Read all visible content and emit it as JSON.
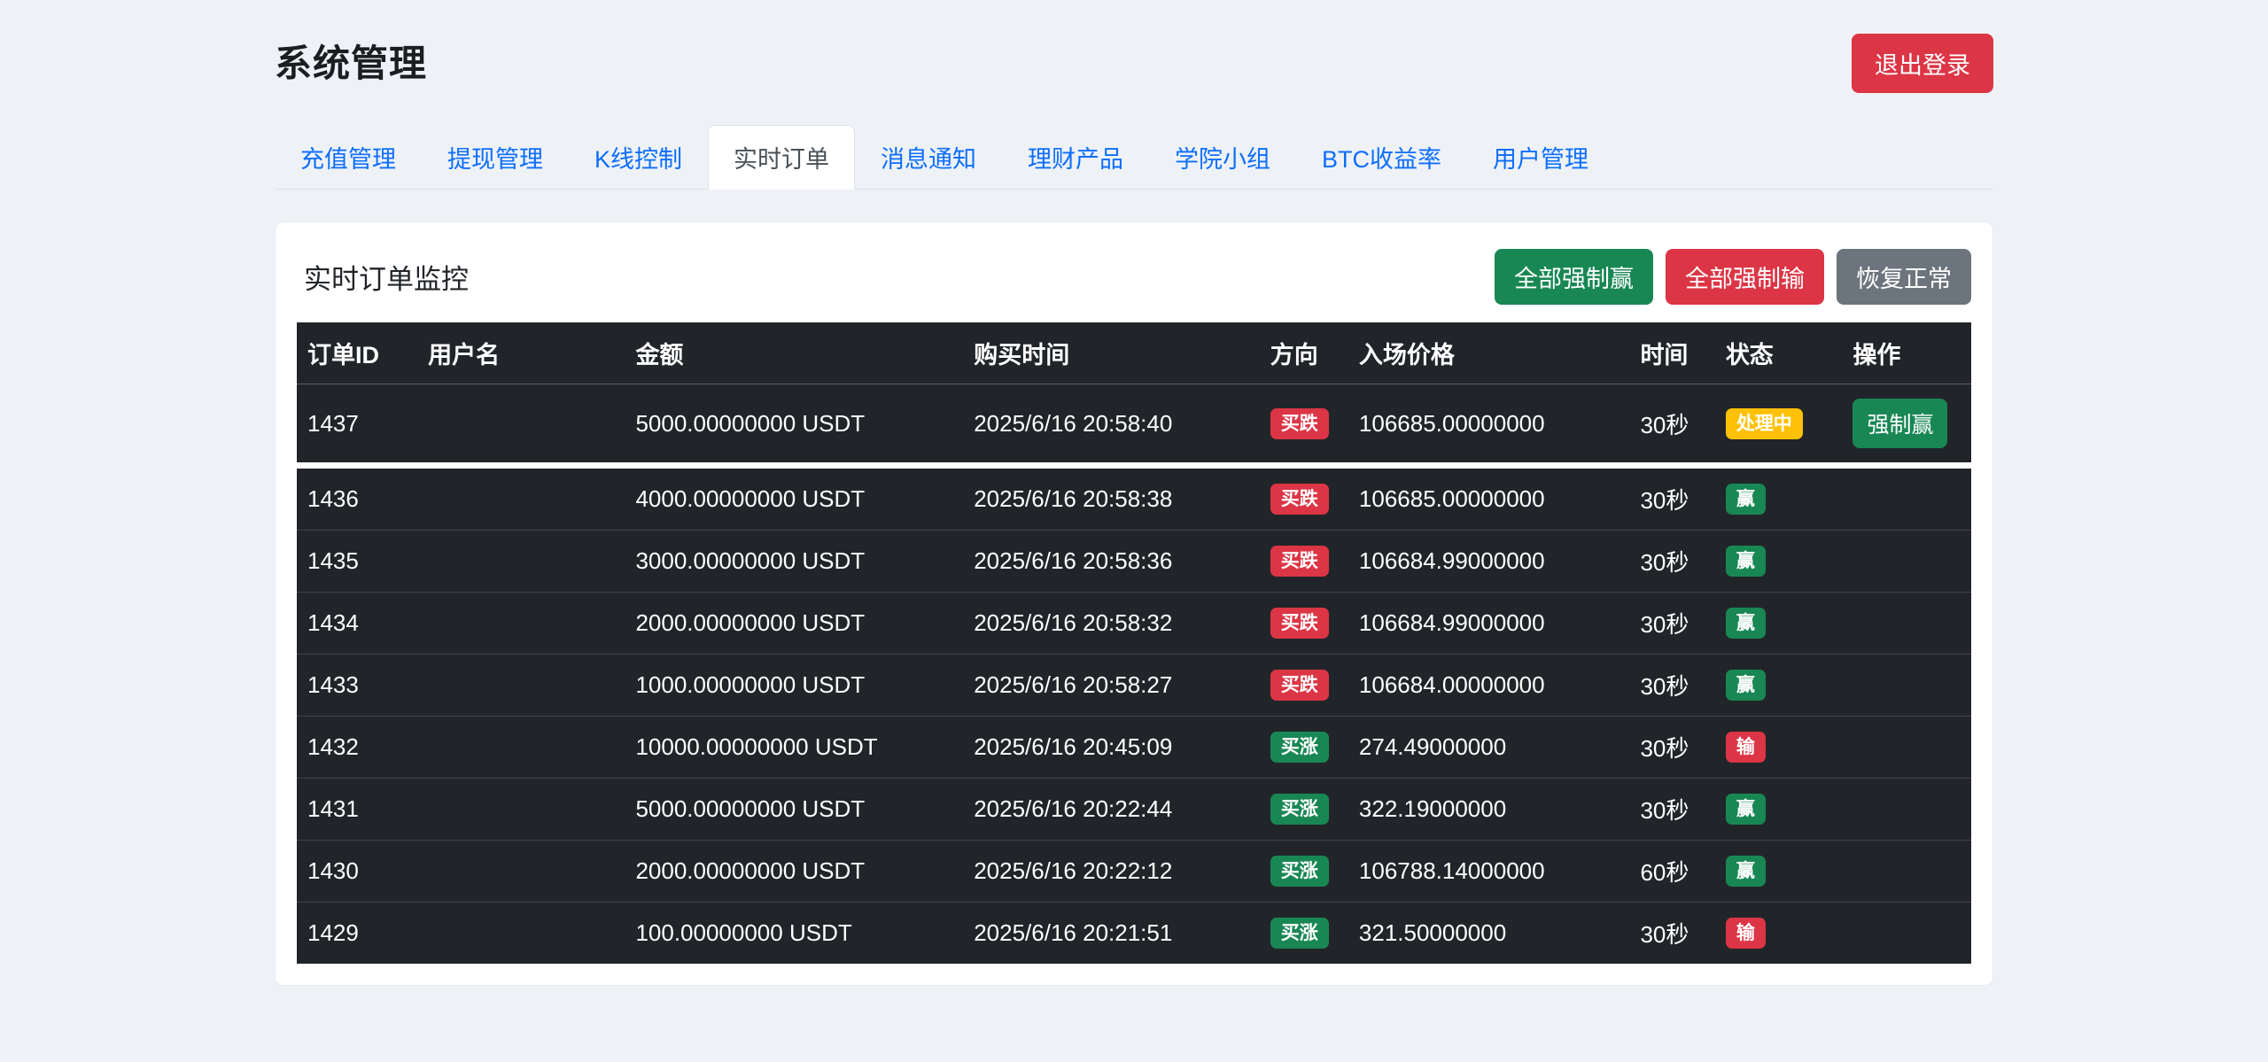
{
  "page": {
    "title": "系统管理",
    "logout_label": "退出登录"
  },
  "tabs": [
    {
      "label": "充值管理",
      "active": false
    },
    {
      "label": "提现管理",
      "active": false
    },
    {
      "label": "K线控制",
      "active": false
    },
    {
      "label": "实时订单",
      "active": true
    },
    {
      "label": "消息通知",
      "active": false
    },
    {
      "label": "理财产品",
      "active": false
    },
    {
      "label": "学院小组",
      "active": false
    },
    {
      "label": "BTC收益率",
      "active": false
    },
    {
      "label": "用户管理",
      "active": false
    }
  ],
  "panel": {
    "title": "实时订单监控",
    "buttons": [
      {
        "name": "force-all-win-button",
        "label": "全部强制赢",
        "variant": "success"
      },
      {
        "name": "force-all-lose-button",
        "label": "全部强制输",
        "variant": "danger"
      },
      {
        "name": "restore-normal-button",
        "label": "恢复正常",
        "variant": "secondary"
      }
    ]
  },
  "table": {
    "headers": [
      "订单ID",
      "用户名",
      "金额",
      "购买时间",
      "方向",
      "入场价格",
      "时间",
      "状态",
      "操作"
    ],
    "rows": [
      {
        "id": "1437",
        "username": "",
        "amount": "5000.00000000 USDT",
        "buy_time": "2025/6/16 20:58:40",
        "direction": "买跌",
        "direction_type": "down",
        "price": "106685.00000000",
        "duration": "30秒",
        "status": "处理中",
        "status_type": "processing",
        "action": "强制赢",
        "group_break": true
      },
      {
        "id": "1436",
        "username": "",
        "amount": "4000.00000000 USDT",
        "buy_time": "2025/6/16 20:58:38",
        "direction": "买跌",
        "direction_type": "down",
        "price": "106685.00000000",
        "duration": "30秒",
        "status": "赢",
        "status_type": "win",
        "action": ""
      },
      {
        "id": "1435",
        "username": "",
        "amount": "3000.00000000 USDT",
        "buy_time": "2025/6/16 20:58:36",
        "direction": "买跌",
        "direction_type": "down",
        "price": "106684.99000000",
        "duration": "30秒",
        "status": "赢",
        "status_type": "win",
        "action": ""
      },
      {
        "id": "1434",
        "username": "",
        "amount": "2000.00000000 USDT",
        "buy_time": "2025/6/16 20:58:32",
        "direction": "买跌",
        "direction_type": "down",
        "price": "106684.99000000",
        "duration": "30秒",
        "status": "赢",
        "status_type": "win",
        "action": ""
      },
      {
        "id": "1433",
        "username": "",
        "amount": "1000.00000000 USDT",
        "buy_time": "2025/6/16 20:58:27",
        "direction": "买跌",
        "direction_type": "down",
        "price": "106684.00000000",
        "duration": "30秒",
        "status": "赢",
        "status_type": "win",
        "action": ""
      },
      {
        "id": "1432",
        "username": "",
        "amount": "10000.00000000 USDT",
        "buy_time": "2025/6/16 20:45:09",
        "direction": "买涨",
        "direction_type": "up",
        "price": "274.49000000",
        "duration": "30秒",
        "status": "输",
        "status_type": "lose",
        "action": ""
      },
      {
        "id": "1431",
        "username": "",
        "amount": "5000.00000000 USDT",
        "buy_time": "2025/6/16 20:22:44",
        "direction": "买涨",
        "direction_type": "up",
        "price": "322.19000000",
        "duration": "30秒",
        "status": "赢",
        "status_type": "win",
        "action": ""
      },
      {
        "id": "1430",
        "username": "",
        "amount": "2000.00000000 USDT",
        "buy_time": "2025/6/16 20:22:12",
        "direction": "买涨",
        "direction_type": "up",
        "price": "106788.14000000",
        "duration": "60秒",
        "status": "赢",
        "status_type": "win",
        "action": ""
      },
      {
        "id": "1429",
        "username": "",
        "amount": "100.00000000 USDT",
        "buy_time": "2025/6/16 20:21:51",
        "direction": "买涨",
        "direction_type": "up",
        "price": "321.50000000",
        "duration": "30秒",
        "status": "输",
        "status_type": "lose",
        "action": ""
      }
    ]
  },
  "colors": {
    "success": "#198754",
    "danger": "#dc3545",
    "warning": "#ffc107",
    "secondary": "#6c757d",
    "link": "#0d6efd",
    "table_dark": "#212529",
    "page_bg": "#eef2f7"
  }
}
